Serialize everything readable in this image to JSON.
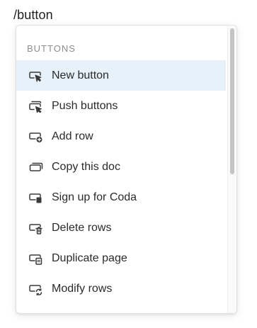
{
  "input": {
    "typed_text": "/button"
  },
  "menu": {
    "section_header": "BUTTONS",
    "items": [
      {
        "label": "New button",
        "icon": "button-cursor-icon",
        "selected": true
      },
      {
        "label": "Push buttons",
        "icon": "push-buttons-icon",
        "selected": false
      },
      {
        "label": "Add row",
        "icon": "add-row-icon",
        "selected": false
      },
      {
        "label": "Copy this doc",
        "icon": "copy-doc-icon",
        "selected": false
      },
      {
        "label": "Sign up for Coda",
        "icon": "sign-up-icon",
        "selected": false
      },
      {
        "label": "Delete rows",
        "icon": "delete-rows-icon",
        "selected": false
      },
      {
        "label": "Duplicate page",
        "icon": "duplicate-page-icon",
        "selected": false
      },
      {
        "label": "Modify rows",
        "icon": "modify-rows-icon",
        "selected": false
      }
    ]
  },
  "colors": {
    "selected_background": "#e7f1f9",
    "text": "#2b2b2b",
    "section_header": "#8e8e8e"
  }
}
